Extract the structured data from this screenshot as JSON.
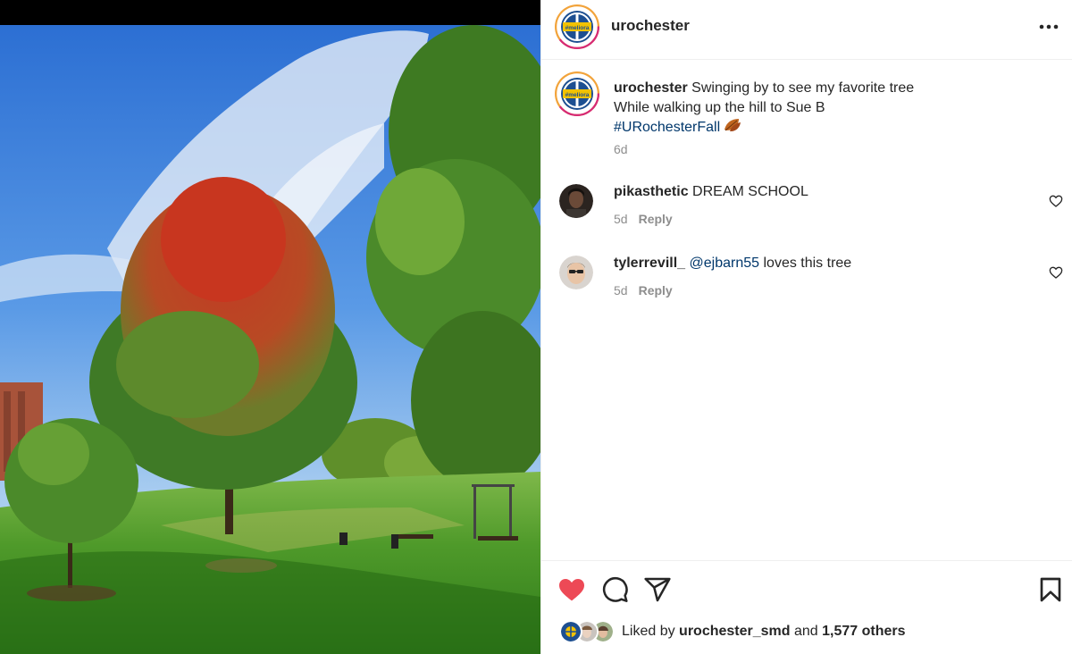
{
  "post": {
    "username": "urochester",
    "avatar_badge_text": "#meliora",
    "caption": {
      "username": "urochester",
      "line1": "Swinging by to see my favorite tree",
      "line2": "While walking up the hill to Sue B",
      "hashtag": "#URochesterFall",
      "emoji_icon": "fallen-leaf-icon",
      "time": "6d"
    },
    "comments": [
      {
        "username": "pikasthetic",
        "text": "DREAM SCHOOL",
        "mention": "",
        "time": "5d",
        "reply_label": "Reply"
      },
      {
        "username": "tylerrevill_",
        "mention": "@ejbarn55",
        "text": "loves this tree",
        "time": "5d",
        "reply_label": "Reply"
      }
    ],
    "likes": {
      "prefix": "Liked by",
      "liker": "urochester_smd",
      "joiner": "and",
      "others": "1,577 others"
    }
  },
  "icons": {
    "more": "more-horizontal-icon",
    "like": "heart-filled-icon",
    "comment": "comment-bubble-icon",
    "share": "paper-plane-icon",
    "save": "bookmark-icon",
    "comment_like": "heart-outline-icon"
  },
  "colors": {
    "like_red": "#ed4956",
    "link_blue": "#00376b",
    "muted_gray": "#8e8e8e",
    "text_dark": "#262626"
  }
}
